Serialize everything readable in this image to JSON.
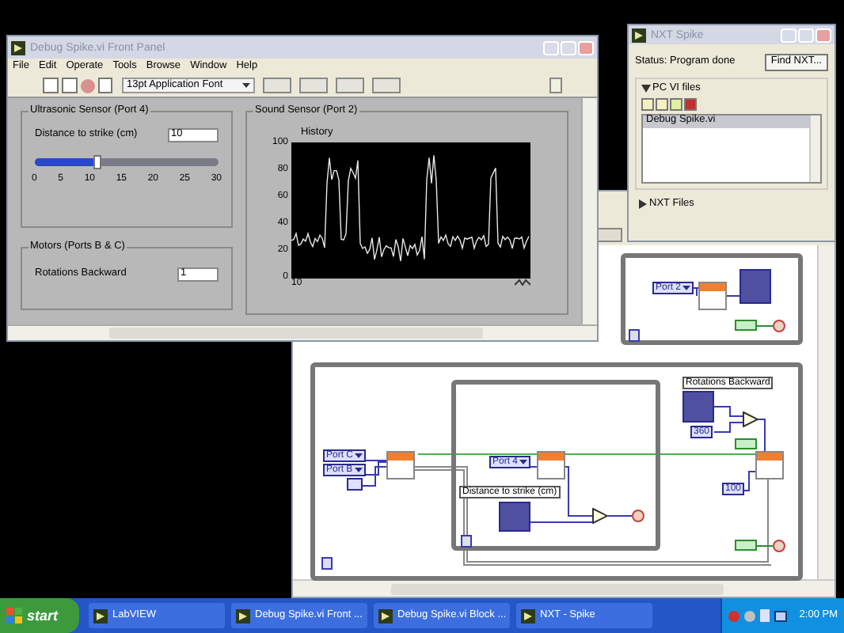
{
  "front_panel": {
    "title": "Debug Spike.vi Front Panel",
    "menu": [
      "File",
      "Edit",
      "Operate",
      "Tools",
      "Browse",
      "Window",
      "Help"
    ],
    "font_selector": "13pt Application Font",
    "ultrasonic": {
      "title": "Ultrasonic Sensor (Port 4)",
      "label": "Distance to strike (cm)",
      "value": "10",
      "slider": {
        "level": 0.333
      },
      "scale": [
        "0",
        "5",
        "10",
        "15",
        "20",
        "25",
        "30"
      ]
    },
    "motors": {
      "title": "Motors (Ports B & C)",
      "label": "Rotations Backward",
      "value": "1"
    },
    "sound": {
      "title": "Sound Sensor (Port 2)",
      "chart_label": "History",
      "y_ticks": [
        "100",
        "80",
        "60",
        "40",
        "20",
        "0"
      ],
      "x_tick": "10"
    }
  },
  "nxt_window": {
    "title": "NXT Spike",
    "status": "Status: Program done",
    "find_button": "Find NXT...",
    "pc_files": {
      "title": "PC VI files",
      "expanded": true,
      "files": [
        {
          "name": "Debug Spike.vi",
          "selected": true
        }
      ]
    },
    "nxt_files": {
      "title": "NXT Files",
      "expanded": false
    }
  },
  "block_diagram": {
    "ports": [
      "Port 2",
      "Port C",
      "Port B",
      "Port 4"
    ],
    "labels": [
      "Distance to strike (cm)",
      "Rotations Backward"
    ],
    "constants": [
      "360",
      "100"
    ]
  },
  "taskbar": {
    "start": "start",
    "items": [
      "LabVIEW",
      "Debug Spike.vi Front ...",
      "Debug Spike.vi Block ...",
      "NXT - Spike"
    ],
    "clock": "2:00 PM"
  }
}
